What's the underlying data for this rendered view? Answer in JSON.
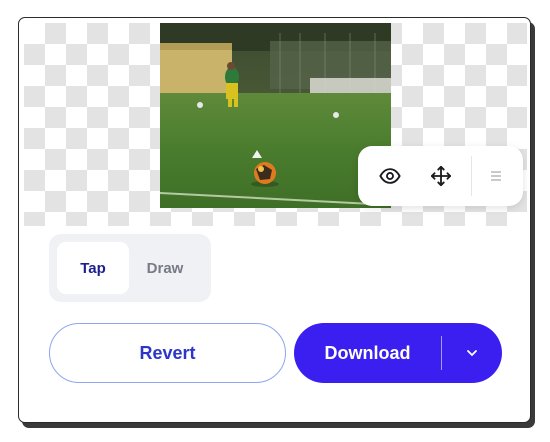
{
  "preview": {
    "image_alt": "Soccer ball on a grass field with a player in the background"
  },
  "view_toolbar": {
    "icons": [
      "eye-icon",
      "move-icon",
      "menu-icon"
    ]
  },
  "mode_toggle": {
    "options": [
      {
        "label": "Tap",
        "active": true
      },
      {
        "label": "Draw",
        "active": false
      }
    ]
  },
  "actions": {
    "revert_label": "Revert",
    "download_label": "Download"
  },
  "colors": {
    "accent": "#3a1ff0",
    "revert_text": "#2c36c9",
    "revert_border": "#8fa5f0",
    "tap_active_text": "#1c1f8f",
    "inactive_text": "#777b85"
  }
}
